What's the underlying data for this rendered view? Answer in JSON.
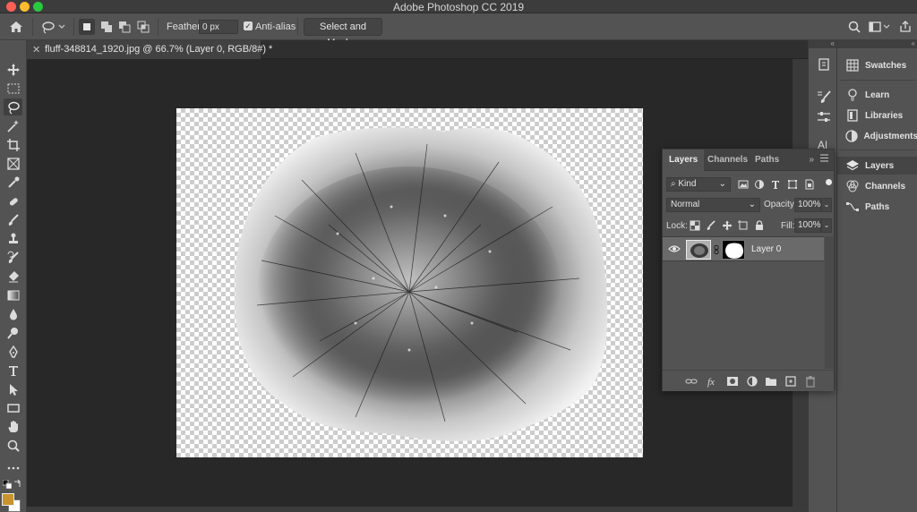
{
  "window": {
    "app_title": "Adobe Photoshop CC 2019"
  },
  "options_bar": {
    "home_icon": "home-icon",
    "tool_icon": "lasso-icon",
    "feather_label": "Feather:",
    "feather_value": "0 px",
    "anti_alias_label": "Anti-alias",
    "anti_alias_checked": true,
    "select_mask_label": "Select and Mask..."
  },
  "document_tab": {
    "title": "fluff-348814_1920.jpg @ 66.7% (Layer 0, RGB/8#) *"
  },
  "colors": {
    "foreground": "#c9932d",
    "background": "#ffffff",
    "accent": "#535353"
  },
  "tools": [
    "move-tool-icon",
    "marquee-tool-icon",
    "lasso-tool-icon",
    "magic-wand-tool-icon",
    "crop-tool-icon",
    "frame-tool-icon",
    "eyedropper-tool-icon",
    "healing-brush-tool-icon",
    "brush-tool-icon",
    "clone-stamp-tool-icon",
    "history-brush-tool-icon",
    "eraser-tool-icon",
    "gradient-tool-icon",
    "blur-tool-icon",
    "dodge-tool-icon",
    "pen-tool-icon",
    "type-tool-icon",
    "path-selection-tool-icon",
    "rectangle-tool-icon",
    "hand-tool-icon",
    "zoom-tool-icon",
    "more-tools-icon"
  ],
  "right_panels": [
    {
      "label": "Swatches"
    },
    {
      "label": "Learn"
    },
    {
      "label": "Libraries"
    },
    {
      "label": "Adjustments"
    },
    {
      "label": "Layers"
    },
    {
      "label": "Channels"
    },
    {
      "label": "Paths"
    }
  ],
  "layers_panel": {
    "tabs": [
      "Layers",
      "Channels",
      "Paths"
    ],
    "filter_kind": "Kind",
    "blend_mode": "Normal",
    "opacity_label": "Opacity:",
    "opacity_value": "100%",
    "lock_label": "Lock:",
    "fill_label": "Fill:",
    "fill_value": "100%",
    "layers": [
      {
        "name": "Layer 0",
        "visible": true
      }
    ]
  }
}
